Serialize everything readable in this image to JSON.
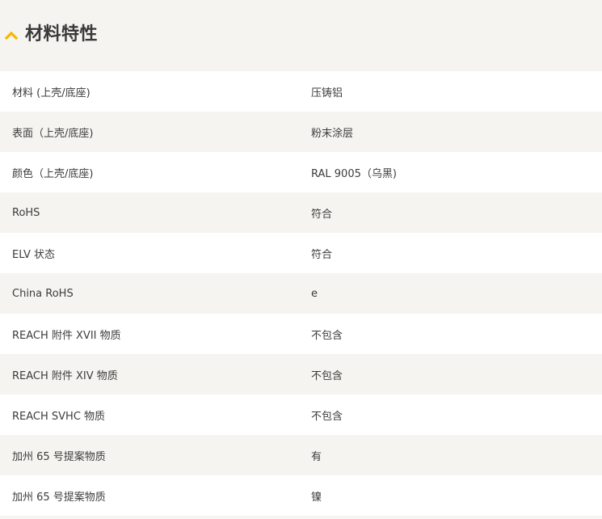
{
  "section": {
    "title": "材料特性",
    "accent_color": "#f5b800",
    "icon": "chevron-up-icon"
  },
  "rows": [
    {
      "name": "材料 (上壳/底座)",
      "value": "压铸铝"
    },
    {
      "name": "表面（上壳/底座)",
      "value": "粉末涂层"
    },
    {
      "name": "颜色（上壳/底座)",
      "value": "RAL 9005（乌黑)"
    },
    {
      "name": "RoHS",
      "value": "符合"
    },
    {
      "name": "ELV 状态",
      "value": "符合"
    },
    {
      "name": "China RoHS",
      "value": "e"
    },
    {
      "name": "REACH 附件 XVII 物质",
      "value": "不包含"
    },
    {
      "name": "REACH 附件 XIV 物质",
      "value": "不包含"
    },
    {
      "name": "REACH SVHC 物质",
      "value": "不包含"
    },
    {
      "name": "加州 65 号提案物质",
      "value": "有"
    },
    {
      "name": "加州 65 号提案物质",
      "value": "镍"
    }
  ]
}
